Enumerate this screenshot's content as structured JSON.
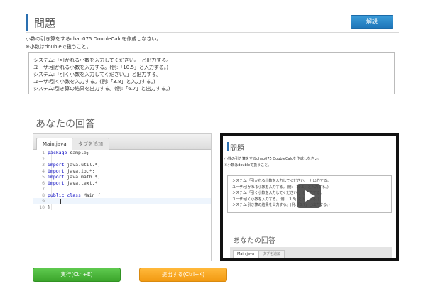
{
  "question": {
    "title": "問題",
    "kaisetsu_label": "解説",
    "desc_line1": "小数の引き算をするchap075 DoubleCalcを作成しなさい。",
    "desc_line2": "※小数はdoubleで扱うこと。",
    "spec_lines": [
      "システム:「引かれる小数を入力してください。」と出力する。",
      "ユーザ:引かれる小数を入力する。(例:「10.5」と入力する。)",
      "システム:「引く小数を入力してください。」と出力する。",
      "ユーザ:引く小数を入力する。(例:「3.8」と入力する。)",
      "システム:引き算の結果を出力する。(例:「6.7」と出力する。)"
    ]
  },
  "answer": {
    "title": "あなたの回答",
    "tab_main": "Main.java",
    "tab_add": "タブを追加",
    "code_lines": [
      {
        "no": "1",
        "text": "package sample;"
      },
      {
        "no": "2",
        "text": ""
      },
      {
        "no": "3",
        "text": "import java.util.*;"
      },
      {
        "no": "4",
        "text": "import java.io.*;"
      },
      {
        "no": "5",
        "text": "import java.math.*;"
      },
      {
        "no": "6",
        "text": "import java.text.*;"
      },
      {
        "no": "7",
        "text": ""
      },
      {
        "no": "8",
        "text": "public class Main {"
      },
      {
        "no": "9",
        "text": ""
      },
      {
        "no": "10",
        "text": "}"
      }
    ],
    "highlighted_line": 9
  },
  "video": {
    "title": "問題",
    "desc_line1": "小数の引き算をするchap075 DoubleCalcを作成しなさい。",
    "desc_line2": "※小数はdoubleで扱うこと。",
    "spec_lines": [
      "システム:「引かれる小数を入力してください。」と出力する。",
      "ユーザ:引かれる小数を入力する。(例:「10.5」と入力する。)",
      "システム:「引く小数を入力してください。」と出力する。",
      "ユーザ:引く小数を入力する。(例:「3.8」と入力する。)",
      "システム:引き算の結果を出力する。(例:「6.7」と出力する。)"
    ],
    "answer_title": "あなたの回答",
    "tab_main": "Main.java",
    "tab_add": "タブを追加",
    "play_icon": "play-icon"
  },
  "buttons": {
    "run_label": "実行(Ctrl+E)",
    "submit_label": "提出する(Ctrl+K)"
  },
  "colors": {
    "accent": "#2a6fb0",
    "run": "#4cb83c",
    "submit": "#f5a623"
  }
}
